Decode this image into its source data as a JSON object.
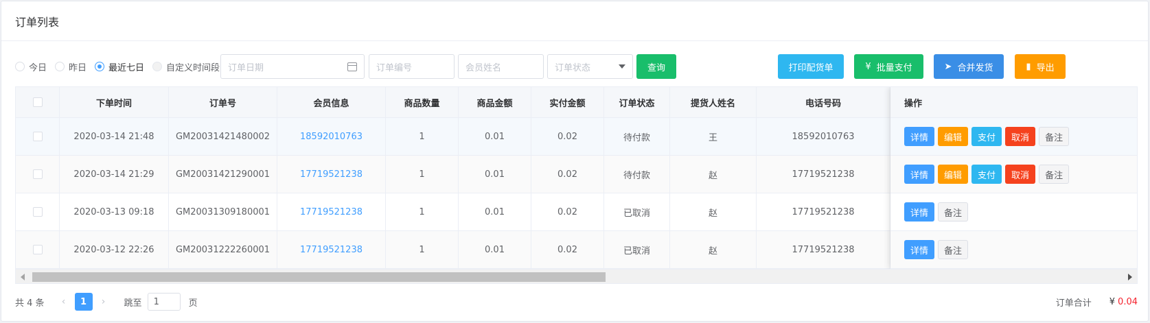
{
  "title": "订单列表",
  "filters": {
    "range_options": [
      {
        "label": "今日",
        "state": "normal"
      },
      {
        "label": "昨日",
        "state": "normal"
      },
      {
        "label": "最近七日",
        "state": "checked"
      },
      {
        "label": "自定义时间段",
        "state": "disabled"
      }
    ],
    "date_placeholder": "订单日期",
    "order_no_placeholder": "订单编号",
    "member_placeholder": "会员姓名",
    "status_placeholder": "订单状态",
    "query_label": "查询"
  },
  "actions": {
    "print_label": "打印配货单",
    "batch_pay_label": "批量支付",
    "merge_ship_label": "合并发货",
    "export_label": "导出",
    "colors": {
      "print": "#2eb7f0",
      "batch_pay": "#19be6b",
      "merge_ship": "#3a8ee6",
      "export": "#ff9c00",
      "query": "#19be6b"
    }
  },
  "table": {
    "columns": [
      "下单时间",
      "订单号",
      "会员信息",
      "商品数量",
      "商品金额",
      "实付金额",
      "订单状态",
      "提货人姓名",
      "电话号码"
    ],
    "action_header": "操作",
    "rows": [
      {
        "time": "2020-03-14 21:48",
        "order_no": "GM20031421480002",
        "member": "18592010763",
        "qty": "1",
        "amount": "0.01",
        "paid": "0.02",
        "status": "待付款",
        "picker": "王",
        "phone": "18592010763",
        "buttons": [
          "详情",
          "编辑",
          "支付",
          "取消",
          "备注"
        ]
      },
      {
        "time": "2020-03-14 21:29",
        "order_no": "GM20031421290001",
        "member": "17719521238",
        "qty": "1",
        "amount": "0.01",
        "paid": "0.02",
        "status": "待付款",
        "picker": "赵",
        "phone": "17719521238",
        "buttons": [
          "详情",
          "编辑",
          "支付",
          "取消",
          "备注"
        ]
      },
      {
        "time": "2020-03-13 09:18",
        "order_no": "GM20031309180001",
        "member": "17719521238",
        "qty": "1",
        "amount": "0.01",
        "paid": "0.02",
        "status": "已取消",
        "picker": "赵",
        "phone": "17719521238",
        "buttons": [
          "详情",
          "备注"
        ]
      },
      {
        "time": "2020-03-12 22:26",
        "order_no": "GM20031222260001",
        "member": "17719521238",
        "qty": "1",
        "amount": "0.01",
        "paid": "0.02",
        "status": "已取消",
        "picker": "赵",
        "phone": "17719521238",
        "buttons": [
          "详情",
          "备注"
        ]
      }
    ]
  },
  "pagination": {
    "total_text": "共 4 条",
    "current_page": "1",
    "jump_label": "跳至",
    "jump_value": "1",
    "page_unit": "页",
    "prev_icon": "chevron-left-icon",
    "next_icon": "chevron-right-icon"
  },
  "summary": {
    "label": "订单合计",
    "currency": "¥",
    "amount": "0.04"
  }
}
